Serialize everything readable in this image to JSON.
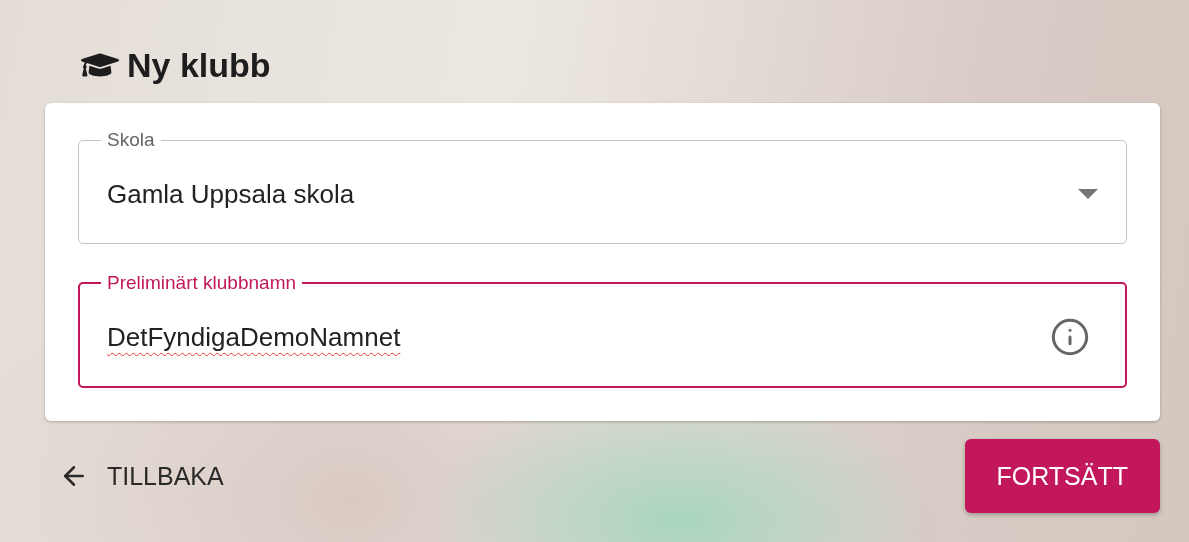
{
  "title": "Ny klubb",
  "fields": [
    {
      "kind": "select",
      "label": "Skola",
      "value": "Gamla Uppsala skola",
      "focused": false,
      "spellcheck_error": false
    },
    {
      "kind": "text",
      "label": "Preliminärt klubbnamn",
      "value": "DetFyndigaDemoNamnet",
      "focused": true,
      "spellcheck_error": true
    }
  ],
  "back_button": {
    "label": "TILLBAKA"
  },
  "continue_button": {
    "label": "FORTSÄTT"
  }
}
